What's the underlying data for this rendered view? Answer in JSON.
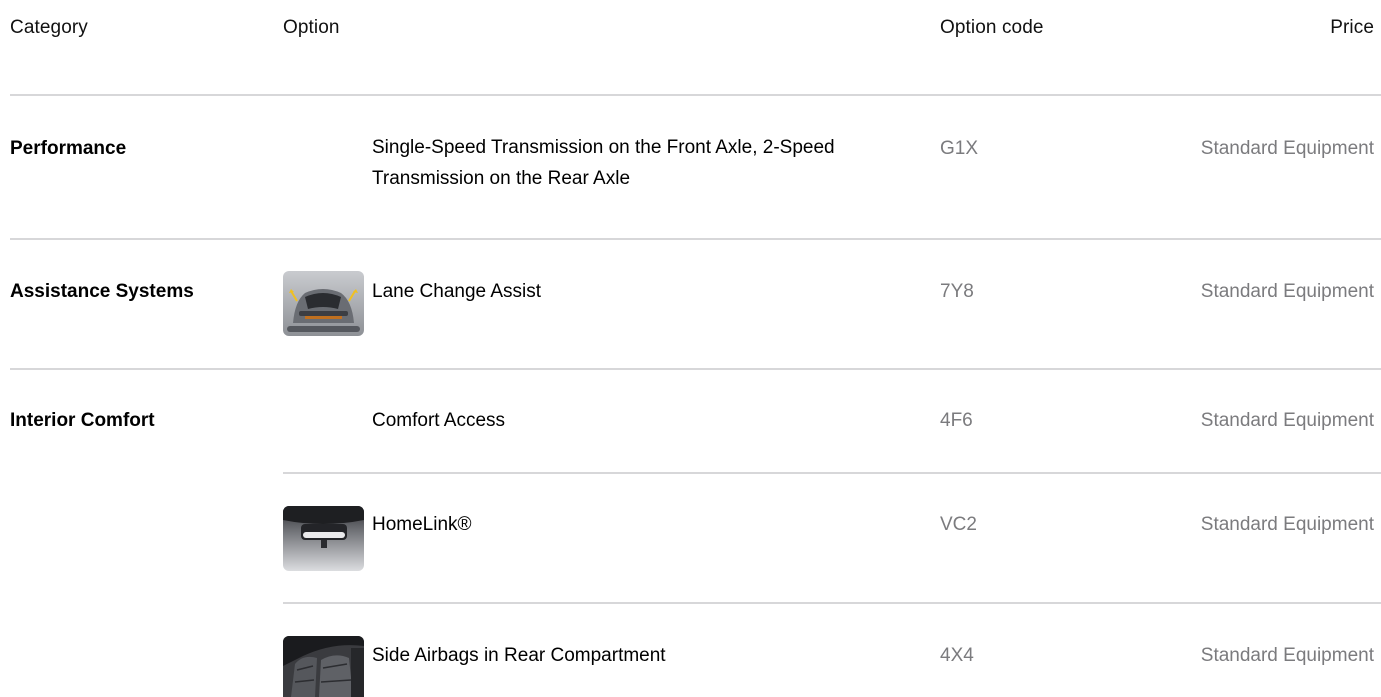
{
  "table": {
    "headers": {
      "category": "Category",
      "option": "Option",
      "option_code": "Option code",
      "price": "Price"
    },
    "rows": [
      {
        "category": "Performance",
        "option": "Single-Speed Transmission on the Front Axle, 2-Speed Transmission on the Rear Axle",
        "code": "G1X",
        "price": "Standard Equipment",
        "thumbnail": null
      },
      {
        "category": "Assistance Systems",
        "option": "Lane Change Assist",
        "code": "7Y8",
        "price": "Standard Equipment",
        "thumbnail": "lane-change-assist-car-rear-image"
      },
      {
        "category": "Interior Comfort",
        "option": "Comfort Access",
        "code": "4F6",
        "price": "Standard Equipment",
        "thumbnail": null
      },
      {
        "category": "",
        "option": "HomeLink®",
        "code": "VC2",
        "price": "Standard Equipment",
        "thumbnail": "homelink-rearview-mirror-image"
      },
      {
        "category": "",
        "option": "Side Airbags in Rear Compartment",
        "code": "4X4",
        "price": "Standard Equipment",
        "thumbnail": "rear-seat-interior-image"
      }
    ]
  },
  "colors": {
    "text_primary": "#000000",
    "text_secondary": "#7b7b7e",
    "divider": "#d7d7d9"
  }
}
